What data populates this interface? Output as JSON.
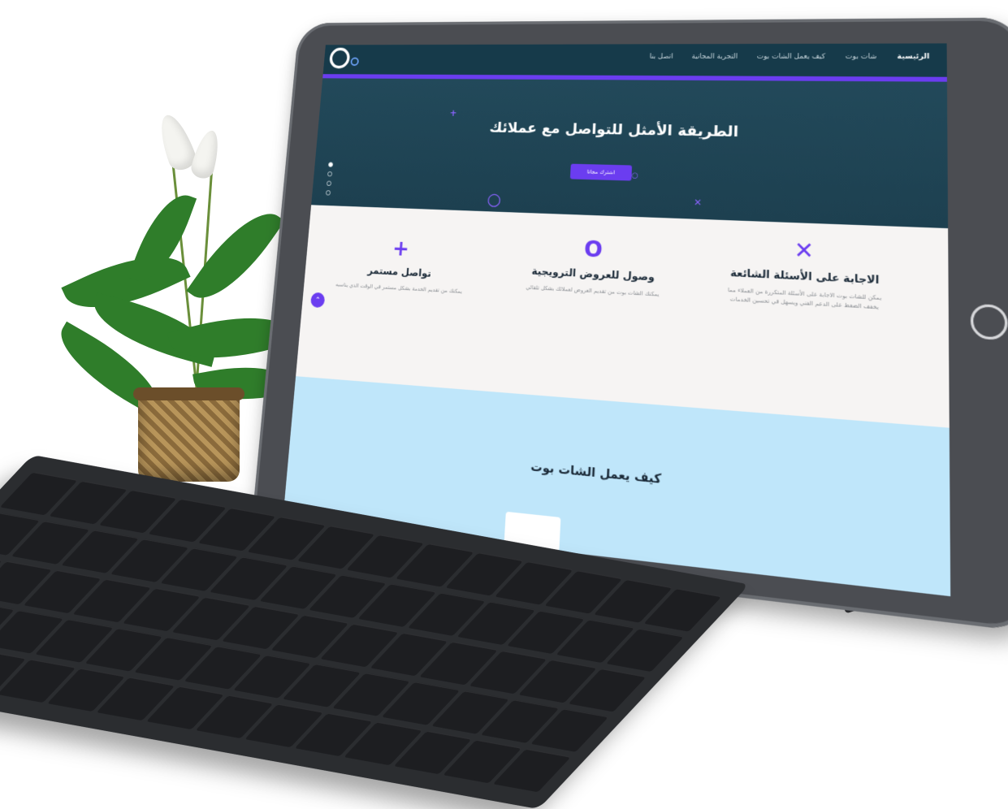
{
  "navbar": {
    "items": [
      "الرئيسية",
      "شات بوت",
      "كيف يعمل الشات بوت",
      "التجربة المجانية",
      "اتصل بنا"
    ],
    "active_index": 0
  },
  "hero": {
    "title": "الطريقة الأمثل للتواصل مع عملائك",
    "button_label": "اشترك مجانا",
    "slide_count": 4,
    "active_slide": 0
  },
  "features": [
    {
      "icon": "plus-icon",
      "icon_glyph": "+",
      "title": "تواصل مستمر",
      "text": "يمكنك من تقديم الخدمة بشكل مستمر في الوقت الذي يناسبه"
    },
    {
      "icon": "circle-icon",
      "icon_glyph": "O",
      "title": "وصول للعروض الترويجية",
      "text": "يمكنك الشات بوت من تقديم العروض لعملائك بشكل تلقائي"
    },
    {
      "icon": "x-icon",
      "icon_glyph": "✕",
      "title": "الاجابة على الأسئلة الشائعة",
      "text": "يمكن للشات بوت الاجابة على الأسئلة المتكررة من العملاء مما يخفف الضغط على الدعم الفني ويسهل في تحسين الخدمات"
    }
  ],
  "how_section": {
    "title": "كيف يعمل الشات بوت"
  },
  "colors": {
    "accent": "#6b3df0",
    "navbar": "#163a4a",
    "hero": "#22495a",
    "how_bg": "#bfe6fa"
  }
}
